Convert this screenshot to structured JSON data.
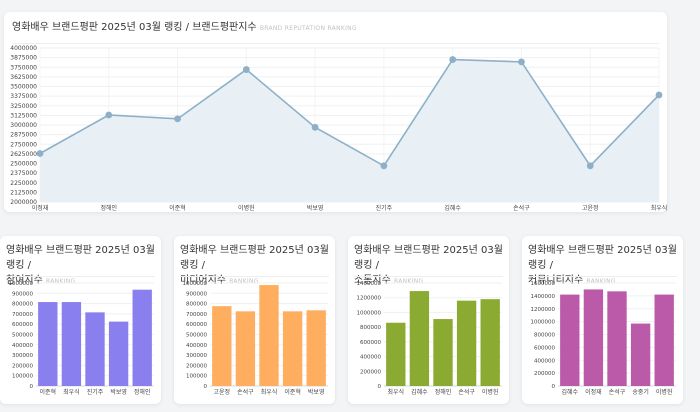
{
  "main_chart": {
    "title": "영화배우 브랜드평판 2025년 03월 랭킹 / 브랜드평판지수",
    "subtitle": "BRAND REPUTATION RANKING",
    "color": "#8db0c8",
    "fill": "#e8f0f5"
  },
  "small_charts": [
    {
      "title_line1": "영화배우 브랜드평판 2025년 03월 랭킹 /",
      "title_line2": "참여지수",
      "subtitle": "RANKING",
      "color": "#8a7fee"
    },
    {
      "title_line1": "영화배우 브랜드평판 2025년 03월 랭킹 /",
      "title_line2": "미디어지수",
      "subtitle": "RANKING",
      "color": "#ffad5f"
    },
    {
      "title_line1": "영화배우 브랜드평판 2025년 03월 랭킹 /",
      "title_line2": "소통지수",
      "subtitle": "RANKING",
      "color": "#8aaa32"
    },
    {
      "title_line1": "영화배우 브랜드평판 2025년 03월 랭킹 /",
      "title_line2": "커뮤니티지수",
      "subtitle": "RANKING",
      "color": "#bb5aa8"
    }
  ],
  "chart_data": [
    {
      "type": "area",
      "title": "영화배우 브랜드평판 2025년 03월 랭킹 / 브랜드평판지수",
      "categories": [
        "이정재",
        "정해인",
        "이준혁",
        "이병헌",
        "박보영",
        "진기주",
        "김혜수",
        "손석구",
        "고윤정",
        "최우식"
      ],
      "values": [
        2630000,
        3130000,
        3080000,
        3720000,
        2970000,
        2470000,
        3850000,
        3820000,
        2470000,
        3390000
      ],
      "ylim": [
        2000000,
        4000000
      ],
      "yticks": [
        2000000,
        2125000,
        2250000,
        2375000,
        2500000,
        2625000,
        2750000,
        2875000,
        3000000,
        3125000,
        3250000,
        3375000,
        3500000,
        3625000,
        3750000,
        3875000,
        4000000
      ],
      "grid": true
    },
    {
      "type": "bar",
      "title": "영화배우 브랜드평판 2025년 03월 랭킹 / 참여지수",
      "categories": [
        "이준혁",
        "최우식",
        "진기주",
        "박보영",
        "정해인"
      ],
      "values": [
        815000,
        815000,
        715000,
        625000,
        935000
      ],
      "ylim": [
        0,
        1000000
      ],
      "yticks": [
        0,
        100000,
        200000,
        300000,
        400000,
        500000,
        600000,
        700000,
        800000,
        900000,
        1000000
      ]
    },
    {
      "type": "bar",
      "title": "영화배우 브랜드평판 2025년 03월 랭킹 / 미디어지수",
      "categories": [
        "고윤정",
        "손석구",
        "최우식",
        "이준혁",
        "박보영"
      ],
      "values": [
        775000,
        725000,
        980000,
        725000,
        735000
      ],
      "ylim": [
        0,
        1000000
      ],
      "yticks": [
        0,
        100000,
        200000,
        300000,
        400000,
        500000,
        600000,
        700000,
        800000,
        900000,
        1000000
      ]
    },
    {
      "type": "bar",
      "title": "영화배우 브랜드평판 2025년 03월 랭킹 / 소통지수",
      "categories": [
        "최우식",
        "김혜수",
        "정해인",
        "손석구",
        "이병헌"
      ],
      "values": [
        860000,
        1290000,
        910000,
        1160000,
        1180000
      ],
      "ylim": [
        0,
        1400000
      ],
      "yticks": [
        0,
        200000,
        400000,
        600000,
        800000,
        1000000,
        1200000,
        1400000
      ]
    },
    {
      "type": "bar",
      "title": "영화배우 브랜드평판 2025년 03월 랭킹 / 커뮤니티지수",
      "categories": [
        "김혜수",
        "이정재",
        "손석구",
        "송중기",
        "이병헌"
      ],
      "values": [
        1420000,
        1500000,
        1470000,
        970000,
        1420000
      ],
      "ylim": [
        0,
        1600000
      ],
      "yticks": [
        0,
        200000,
        400000,
        600000,
        800000,
        1000000,
        1200000,
        1400000,
        1600000
      ]
    }
  ]
}
